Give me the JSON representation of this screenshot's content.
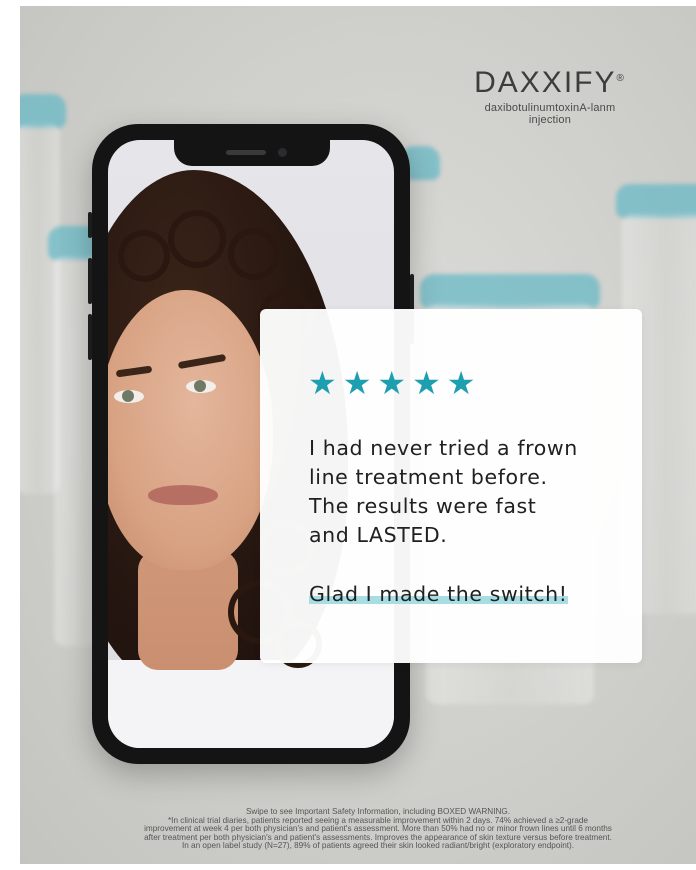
{
  "brand": {
    "name": "DAXXIFY",
    "registered_mark": "®",
    "subtitle": "daxibotulinumtoxinA-lanm injection"
  },
  "review": {
    "rating": 5,
    "stars": [
      "★",
      "★",
      "★",
      "★",
      "★"
    ],
    "lines": [
      "I had never tried a frown",
      "line treatment before.",
      "The results were fast",
      "and LASTED."
    ],
    "closing": "Glad I made the switch!"
  },
  "disclaimer": {
    "lines": [
      "Swipe to see Important Safety Information, including BOXED WARNING.",
      "*In clinical trial diaries, patients reported seeing a measurable improvement within 2 days. 74% achieved a ≥2-grade",
      "improvement at week 4 per both physician's and patient's assessment. More than 50% had no or minor frown lines until 6 months",
      "after treatment per both physician's and patient's assessments. Improves the appearance of skin texture versus before treatment.",
      "In an open label study (N=27), 89% of patients agreed their skin looked radiant/bright (exploratory endpoint)."
    ]
  },
  "colors": {
    "accent": "#1e9fb0",
    "highlight": "#a8dde4",
    "vial_cap": "#66b9c6"
  }
}
